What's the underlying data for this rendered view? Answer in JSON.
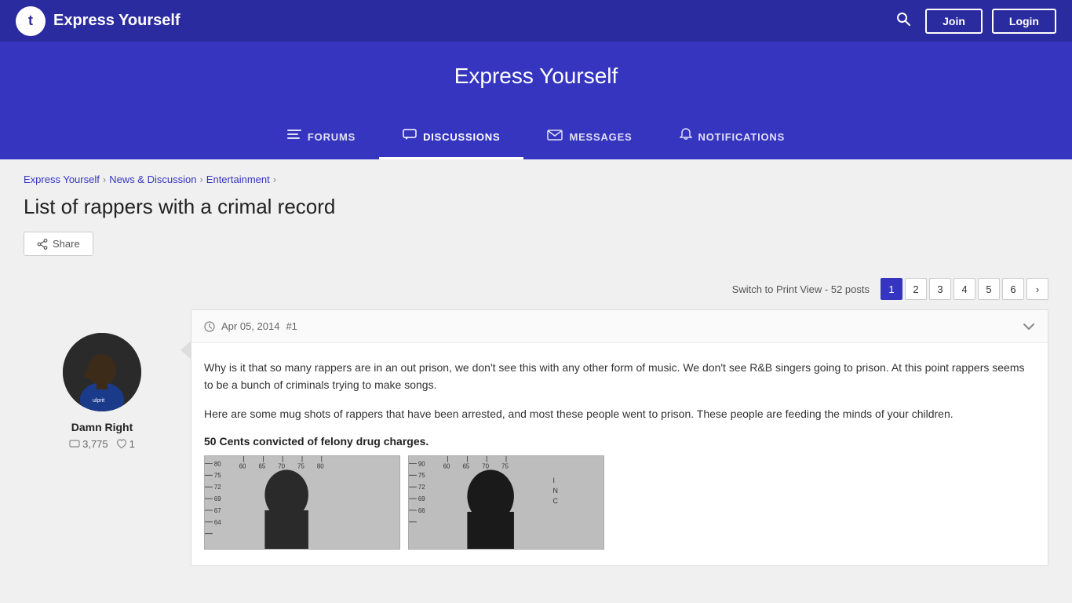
{
  "site": {
    "logo_letter": "t",
    "title": "Express Yourself"
  },
  "header": {
    "title": "Express Yourself"
  },
  "top_nav": {
    "search_label": "Search",
    "join_label": "Join",
    "login_label": "Login"
  },
  "nav_tabs": [
    {
      "id": "forums",
      "label": "FORUMS",
      "icon": "≡",
      "active": false
    },
    {
      "id": "discussions",
      "label": "DISCUSSIONS",
      "icon": "💬",
      "active": true
    },
    {
      "id": "messages",
      "label": "MESSAGES",
      "icon": "✉",
      "active": false
    },
    {
      "id": "notifications",
      "label": "NOTIFICATIONS",
      "icon": "🔔",
      "active": false
    }
  ],
  "breadcrumb": {
    "items": [
      {
        "label": "Express Yourself",
        "href": "#"
      },
      {
        "label": "News & Discussion",
        "href": "#"
      },
      {
        "label": "Entertainment",
        "href": "#"
      }
    ]
  },
  "page": {
    "title": "List of rappers with a crimal record",
    "share_label": "Share"
  },
  "pagination": {
    "print_view_text": "Switch to Print View - 52 posts",
    "pages": [
      "1",
      "2",
      "3",
      "4",
      "5",
      "6"
    ],
    "active_page": "1",
    "next_label": "›"
  },
  "post": {
    "date": "Apr 05, 2014",
    "post_number": "#1",
    "author": {
      "name": "Damn Right",
      "comments": "3,775",
      "likes": "1"
    },
    "paragraphs": [
      "Why is it that so many rappers are in an out prison, we don't see this with any other form of music. We don't see R&B singers going to prison. At this point rappers seems to be a bunch of criminals trying to make songs.",
      "Here are some mug shots of rappers that have been arrested, and most these people went to prison. These people are feeding the minds of your children."
    ],
    "highlighted_text": "50 Cents convicted of felony drug charges."
  }
}
